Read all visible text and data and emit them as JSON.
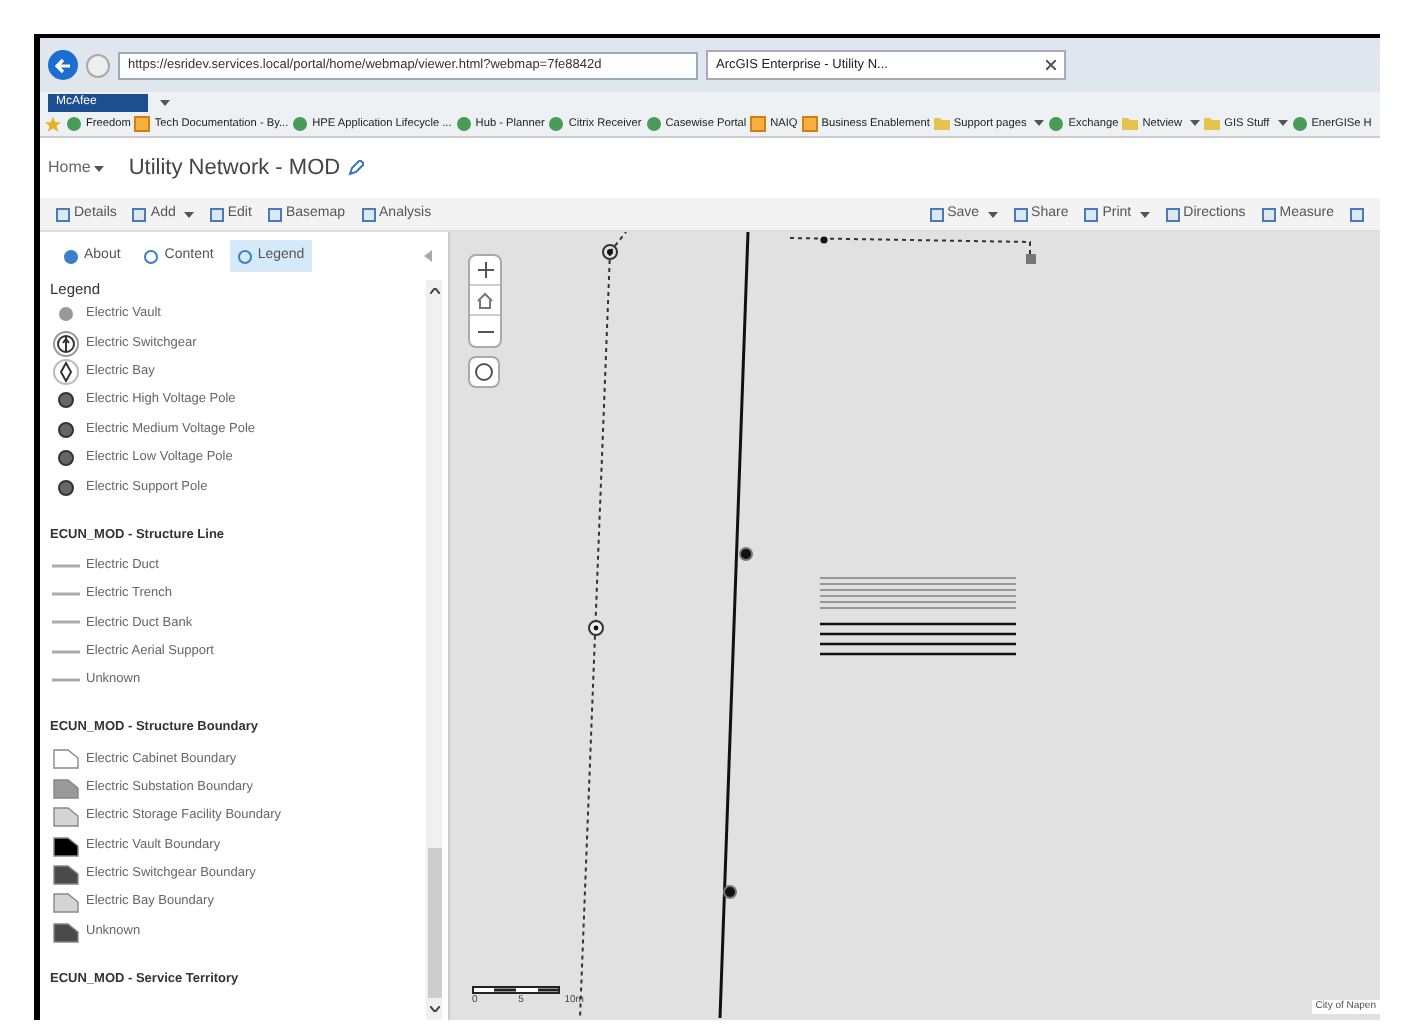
{
  "browser": {
    "url": "https://esridev.services.local/portal/home/webmap/viewer.html?webmap=7fe8842d",
    "tab": "ArcGIS Enterprise - Utility N...",
    "addon": "McAfee"
  },
  "favorites": [
    {
      "label": "Freedom",
      "kind": "site",
      "dropdown": false
    },
    {
      "label": "Tech Documentation - By...",
      "kind": "page",
      "dropdown": false
    },
    {
      "label": "HPE Application Lifecycle ...",
      "kind": "site",
      "dropdown": false
    },
    {
      "label": "Hub - Planner",
      "kind": "site",
      "dropdown": false
    },
    {
      "label": "Citrix Receiver",
      "kind": "site",
      "dropdown": false
    },
    {
      "label": "Casewise Portal",
      "kind": "site",
      "dropdown": false
    },
    {
      "label": "NAIQ",
      "kind": "page",
      "dropdown": false
    },
    {
      "label": "Business Enablement",
      "kind": "page",
      "dropdown": false
    },
    {
      "label": "Support pages",
      "kind": "folder",
      "dropdown": true
    },
    {
      "label": "Exchange",
      "kind": "site",
      "dropdown": false
    },
    {
      "label": "Netview",
      "kind": "folder",
      "dropdown": true
    },
    {
      "label": "GIS Stuff",
      "kind": "folder",
      "dropdown": true
    },
    {
      "label": "EnerGISe H",
      "kind": "site",
      "dropdown": false
    }
  ],
  "header": {
    "home": "Home",
    "title": "Utility Network - MOD"
  },
  "toolbar_left": [
    {
      "label": "Details",
      "dropdown": false
    },
    {
      "label": "Add",
      "dropdown": true
    },
    {
      "label": "Edit",
      "dropdown": false
    },
    {
      "label": "Basemap",
      "dropdown": false
    },
    {
      "label": "Analysis",
      "dropdown": false
    }
  ],
  "toolbar_right": [
    {
      "label": "Save",
      "dropdown": true
    },
    {
      "label": "Share",
      "dropdown": false
    },
    {
      "label": "Print",
      "dropdown": true
    },
    {
      "label": "Directions",
      "dropdown": false
    },
    {
      "label": "Measure",
      "dropdown": false
    }
  ],
  "tabs": [
    {
      "label": "About",
      "selected": false
    },
    {
      "label": "Content",
      "selected": false
    },
    {
      "label": "Legend",
      "selected": true
    }
  ],
  "legend": {
    "title": "Legend",
    "groups": [
      {
        "items": [
          {
            "label": "Electric Vault",
            "kind": "dot"
          },
          {
            "label": "Electric Switchgear",
            "kind": "switchgear"
          },
          {
            "label": "Electric Bay",
            "kind": "bay"
          },
          {
            "label": "Electric High Voltage Pole",
            "kind": "pole"
          },
          {
            "label": "Electric Medium Voltage Pole",
            "kind": "pole"
          },
          {
            "label": "Electric Low Voltage Pole",
            "kind": "pole"
          },
          {
            "label": "Electric Support Pole",
            "kind": "pole"
          }
        ]
      },
      {
        "heading": "ECUN_MOD - Structure Line",
        "items": [
          {
            "label": "Electric Duct",
            "kind": "line"
          },
          {
            "label": "Electric Trench",
            "kind": "line"
          },
          {
            "label": "Electric Duct Bank",
            "kind": "line"
          },
          {
            "label": "Electric Aerial Support",
            "kind": "line"
          },
          {
            "label": "Unknown",
            "kind": "line"
          }
        ]
      },
      {
        "heading": "ECUN_MOD - Structure Boundary",
        "items": [
          {
            "label": "Electric Cabinet Boundary",
            "kind": "polygon",
            "color": "#ffffff"
          },
          {
            "label": "Electric Substation Boundary",
            "kind": "polygon",
            "color": "#9a9a9a"
          },
          {
            "label": "Electric Storage Facility Boundary",
            "kind": "polygon",
            "color": "#d4d4d4"
          },
          {
            "label": "Electric Vault Boundary",
            "kind": "polygon",
            "color": "#000000"
          },
          {
            "label": "Electric Switchgear Boundary",
            "kind": "polygon",
            "color": "#4a4a4a"
          },
          {
            "label": "Electric Bay Boundary",
            "kind": "polygon",
            "color": "#d4d4d4"
          },
          {
            "label": "Unknown",
            "kind": "polygon",
            "color": "#4a4a4a"
          }
        ]
      },
      {
        "heading": "ECUN_MOD - Service Territory"
      }
    ]
  },
  "map": {
    "scale": [
      "0",
      "5",
      "10m"
    ],
    "attribution": "City of Napen"
  }
}
